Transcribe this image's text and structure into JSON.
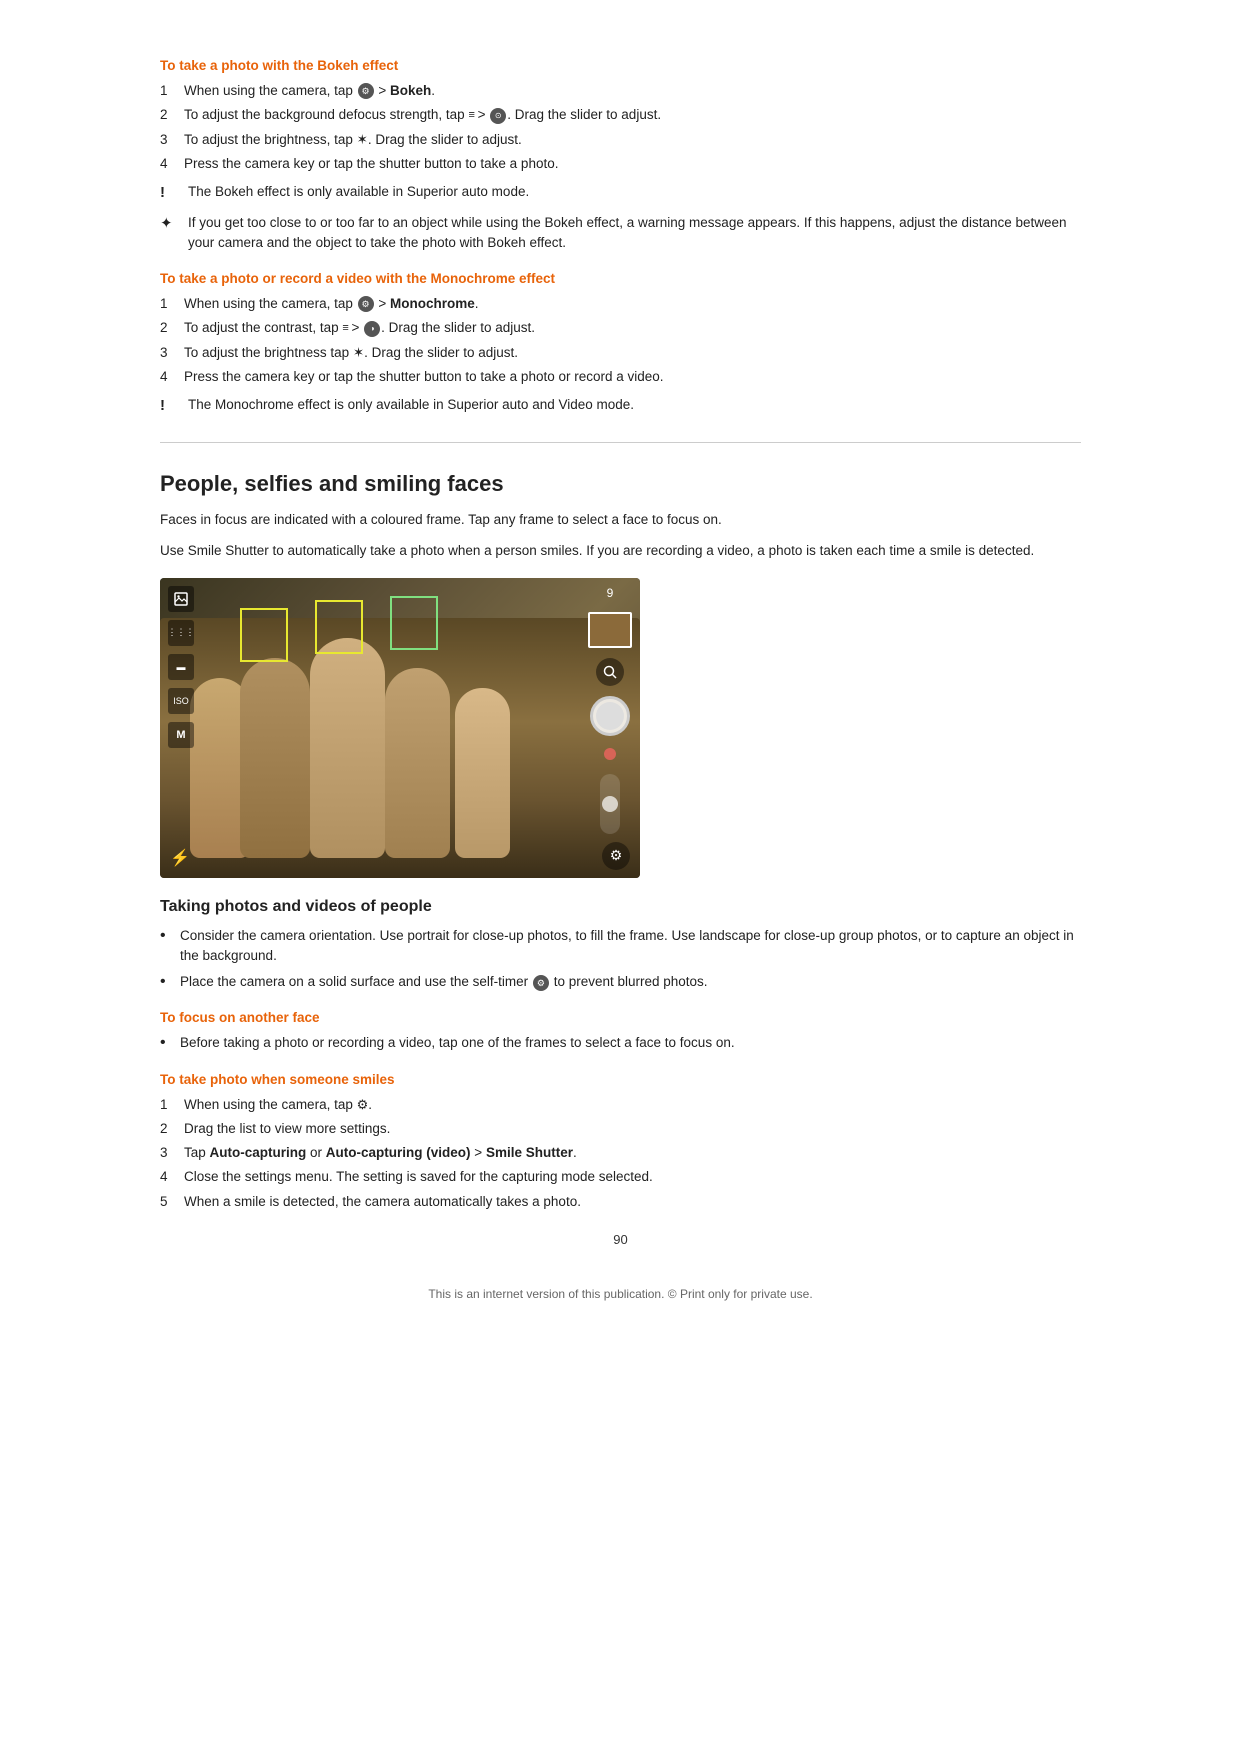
{
  "bokeh_section": {
    "title": "To take a photo with the Bokeh effect",
    "steps": [
      "When using the camera, tap ⓢ > Bokeh.",
      "To adjust the background defocus strength, tap ≣ > ⓛ. Drag the slider to adjust.",
      "To adjust the brightness, tap ✶. Drag the slider to adjust.",
      "Press the camera key or tap the shutter button to take a photo."
    ],
    "note": "The Bokeh effect is only available in Superior auto mode.",
    "tip": "If you get too close to or too far to an object while using the Bokeh effect, a warning message appears. If this happens, adjust the distance between your camera and the object to take the photo with Bokeh effect."
  },
  "monochrome_section": {
    "title": "To take a photo or record a video with the Monochrome effect",
    "steps": [
      "When using the camera, tap ⓢ > Monochrome.",
      "To adjust the contrast, tap ≣ > Ⓧ. Drag the slider to adjust.",
      "To adjust the brightness tap ✶. Drag the slider to adjust.",
      "Press the camera key or tap the shutter button to take a photo or record a video."
    ],
    "note": "The Monochrome effect is only available in Superior auto and Video mode."
  },
  "chapter": {
    "title": "People, selfies and smiling faces",
    "para1": "Faces in focus are indicated with a coloured frame. Tap any frame to select a face to focus on.",
    "para2": "Use Smile Shutter to automatically take a photo when a person smiles. If you are recording a video, a photo is taken each time a smile is detected."
  },
  "taking_photos_subsection": {
    "title": "Taking photos and videos of people",
    "bullets": [
      "Consider the camera orientation. Use portrait for close-up photos, to fill the frame. Use landscape for close-up group photos, or to capture an object in the background.",
      "Place the camera on a solid surface and use the self-timer ⓢ to prevent blurred photos."
    ]
  },
  "focus_section": {
    "title": "To focus on another face",
    "bullet": "Before taking a photo or recording a video, tap one of the frames to select a face to focus on."
  },
  "smile_section": {
    "title": "To take photo when someone smiles",
    "steps": [
      "When using the camera, tap ⚙.",
      "Drag the list to view more settings.",
      "Tap Auto-capturing or Auto-capturing (video) > Smile Shutter.",
      "Close the settings menu. The setting is saved for the capturing mode selected.",
      "When a smile is detected, the camera automatically takes a photo."
    ]
  },
  "page_number": "90",
  "footer": "This is an internet version of this publication. © Print only for private use."
}
